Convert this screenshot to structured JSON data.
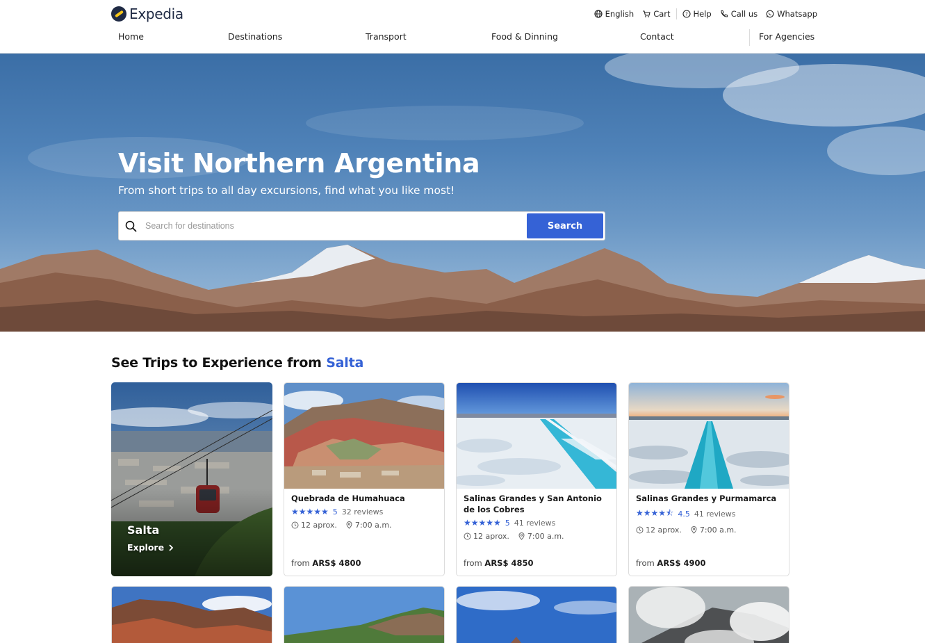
{
  "brand": {
    "name": "Expedia"
  },
  "utility": {
    "language": "English",
    "cart": "Cart",
    "help": "Help",
    "call": "Call us",
    "whatsapp": "Whatsapp"
  },
  "nav": {
    "items": [
      "Home",
      "Destinations",
      "Transport",
      "Food & Dinning",
      "Contact",
      "For Agencies"
    ]
  },
  "hero": {
    "title": "Visit Northern Argentina",
    "subtitle": "From short trips to all day excursions, find what you like most!",
    "search_placeholder": "Search for destinations",
    "search_button": "Search"
  },
  "section": {
    "title_prefix": "See Trips to Experience from ",
    "title_accent": "Salta"
  },
  "feature": {
    "name": "Salta",
    "explore": "Explore"
  },
  "cards": [
    {
      "title": "Quebrada de Humahuaca",
      "rating": "5",
      "reviews": "32 reviews",
      "duration": "12 aprox.",
      "time": "7:00 a.m.",
      "price_prefix": "from",
      "price": "ARS$ 4800"
    },
    {
      "title": "Salinas Grandes y San Antonio de los Cobres",
      "rating": "5",
      "reviews": "41 reviews",
      "duration": "12 aprox.",
      "time": "7:00 a.m.",
      "price_prefix": "from",
      "price": "ARS$ 4850"
    },
    {
      "title": "Salinas Grandes y Purmamarca",
      "rating": "4.5",
      "reviews": "41 reviews",
      "duration": "12 aprox.",
      "time": "7:00 a.m.",
      "price_prefix": "from",
      "price": "ARS$ 4900"
    }
  ],
  "colors": {
    "accent": "#3562d6",
    "brand_dark": "#1f2a44",
    "brand_yellow": "#f5c518"
  }
}
